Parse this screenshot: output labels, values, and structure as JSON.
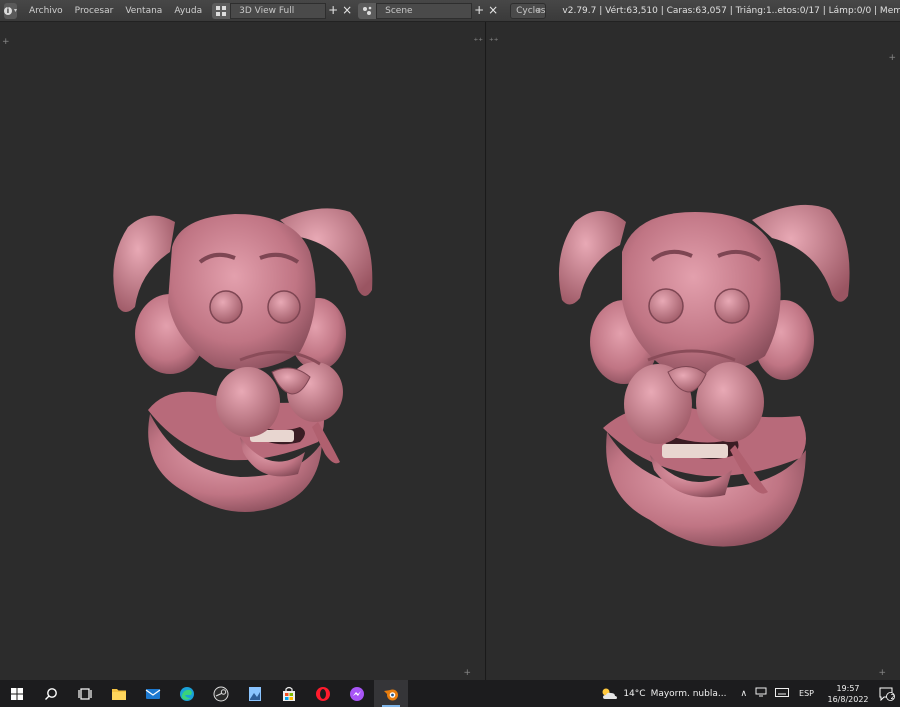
{
  "topbar": {
    "menu": [
      "Archivo",
      "Procesar",
      "Ventana",
      "Ayuda"
    ],
    "layout_name": "3D View Full",
    "scene_name": "Scene",
    "render_engine": "Cycles",
    "stats": "v2.79.7 | Vért:63,510 | Caras:63,057 | Triáng:1..etos:0/17 | Lámp:0/0 | Mem:"
  },
  "taskbar": {
    "apps": [
      "windows-start",
      "search",
      "task-view",
      "file-explorer",
      "mail",
      "edge",
      "steam",
      "app-gallery",
      "store",
      "opera",
      "messenger",
      "blender"
    ],
    "active_app": "blender",
    "weather_temp": "14°C",
    "weather_text": "Mayorm. nubla...",
    "language": "ESP",
    "time": "19:57",
    "date": "16/8/2022",
    "notification_count": "2"
  },
  "colors": {
    "viewport_bg": "#2c2c2c",
    "model_pink": "#c97a88",
    "taskbar_bg": "#1c1c1e",
    "header_bg": "#3d3d3d"
  }
}
